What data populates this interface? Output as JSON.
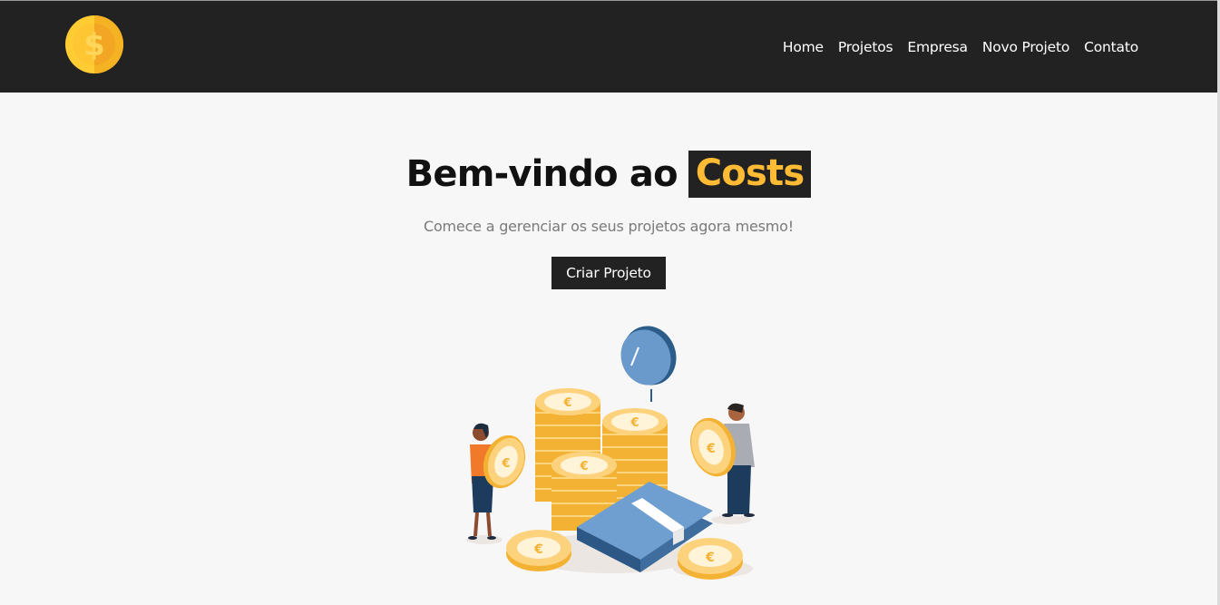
{
  "navbar": {
    "logo_alt": "Costs",
    "logo_icon": "dollar-coin-icon",
    "links": [
      "Home",
      "Projetos",
      "Empresa",
      "Novo Projeto",
      "Contato"
    ]
  },
  "hero": {
    "title_prefix": "Bem-vindo ao",
    "title_brand": "Costs",
    "subtitle": "Comece a gerenciar os seus projetos agora mesmo!",
    "cta_label": "Criar Projeto"
  },
  "colors": {
    "navbar_bg": "#222222",
    "accent": "#ffbb33",
    "page_bg": "#f7f7f7"
  },
  "illustration": {
    "icon": "savings-coins-illustration"
  }
}
